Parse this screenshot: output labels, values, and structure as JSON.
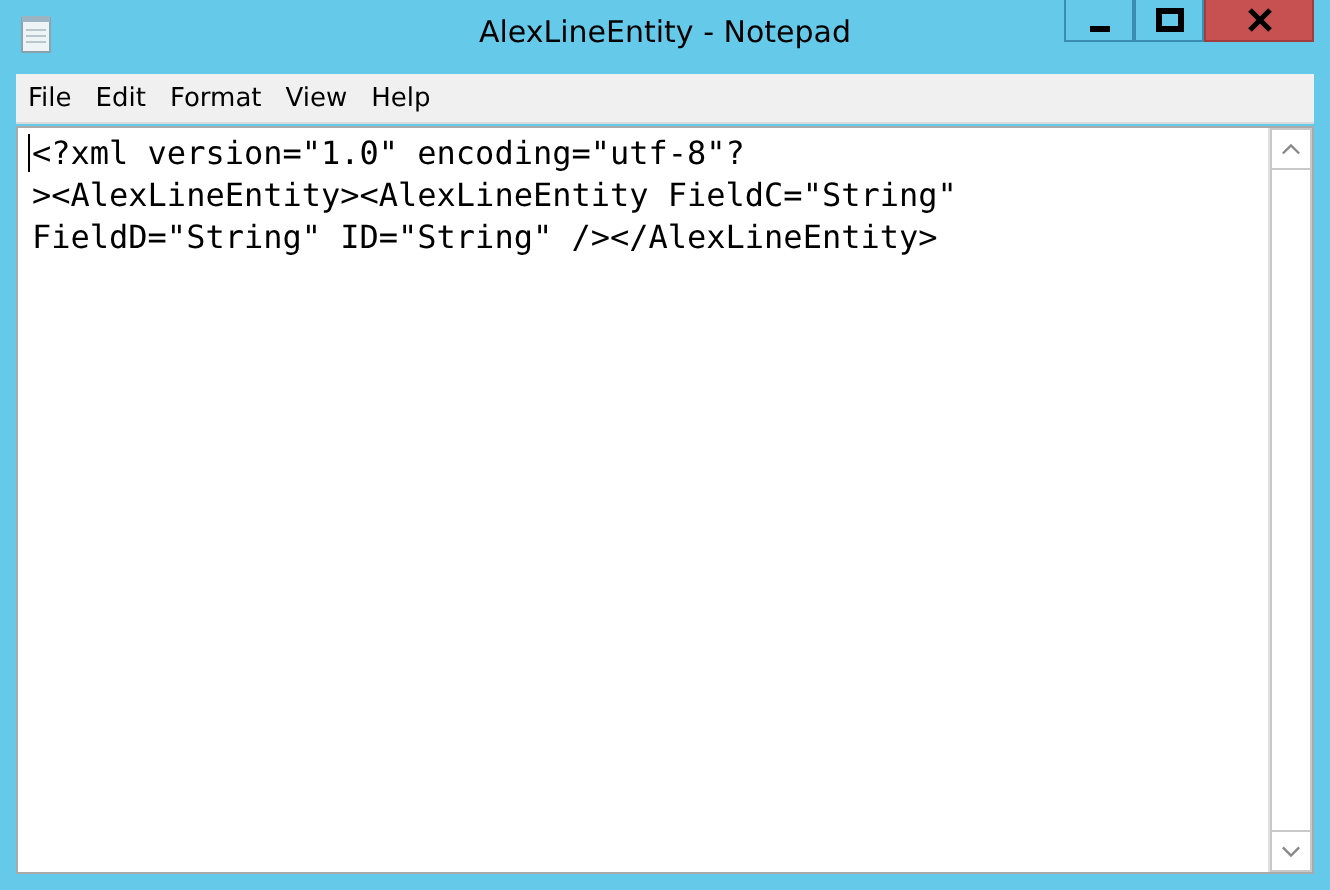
{
  "window": {
    "title": "AlexLineEntity - Notepad"
  },
  "menu": [
    "File",
    "Edit",
    "Format",
    "View",
    "Help"
  ],
  "editor": {
    "lines": [
      "<?xml version=\"1.0\" encoding=\"utf-8\"?",
      "><AlexLineEntity><AlexLineEntity FieldC=\"String\"",
      "FieldD=\"String\" ID=\"String\" /></AlexLineEntity>"
    ]
  }
}
